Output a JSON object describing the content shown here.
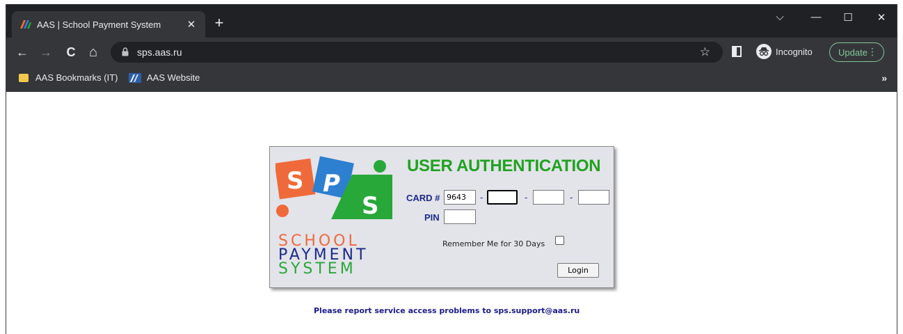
{
  "browser": {
    "tab": {
      "title": "AAS | School Payment System",
      "close_glyph": "✕"
    },
    "new_tab_glyph": "+",
    "window_controls": {
      "dropdown": "⌵",
      "minimize": "—",
      "maximize": "☐",
      "close": "✕"
    },
    "nav": {
      "back": "←",
      "forward": "→",
      "reload": "C",
      "home": "⌂"
    },
    "url": "sps.aas.ru",
    "star_glyph": "☆",
    "incognito_label": "Incognito",
    "update_label": "Update",
    "update_menu_glyph": "⋮",
    "bookmarks": [
      {
        "label": "AAS Bookmarks (IT)",
        "icon": "folder-icon"
      },
      {
        "label": "AAS Website",
        "icon": "aas-site-icon"
      }
    ],
    "bookmarks_more": "»"
  },
  "logo": {
    "letters": [
      "S",
      "P",
      "S"
    ],
    "line1": "SCHOOL",
    "line2": "PAYMENT",
    "line3": "SYSTEM"
  },
  "auth": {
    "title": "USER AUTHENTICATION",
    "card_label": "CARD #",
    "card_parts": [
      "9643",
      "",
      "",
      ""
    ],
    "dash": "-",
    "pin_label": "PIN",
    "pin_value": "",
    "remember_label": "Remember Me for 30 Days",
    "remember_checked": false,
    "login_label": "Login"
  },
  "footer_note": "Please report service access problems to sps.support@aas.ru",
  "colors": {
    "brand_green": "#1fa31f",
    "brand_blue": "#1a2a8c",
    "logo_orange": "#ef6a3a",
    "logo_blue": "#2d7fd0",
    "logo_green": "#29a83a"
  }
}
